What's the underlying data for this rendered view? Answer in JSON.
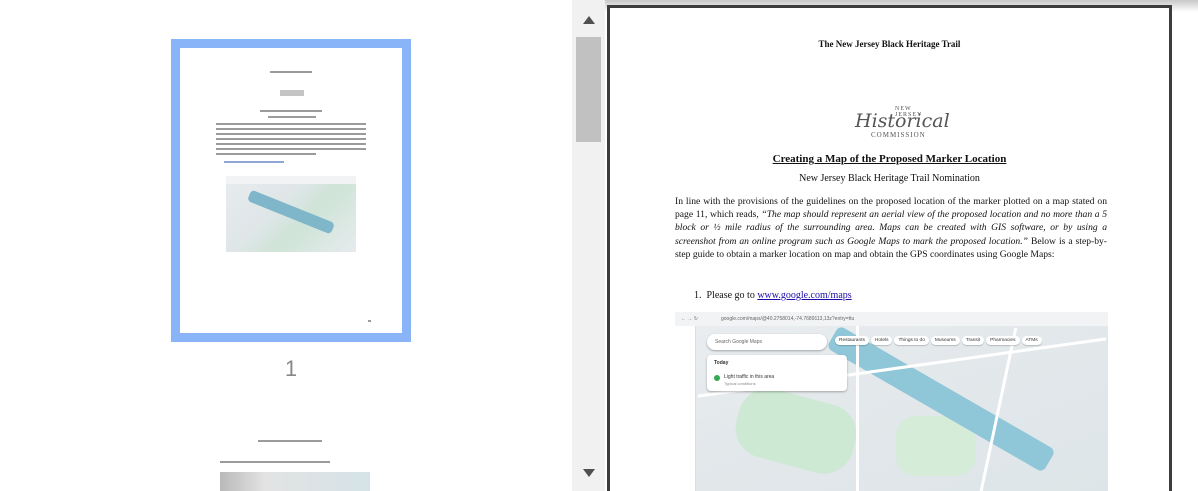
{
  "sidebar": {
    "page_number": "1"
  },
  "document": {
    "header": "The New Jersey Black Heritage Trail",
    "logo": {
      "top": "NEW JERSEY",
      "script": "Historical",
      "bottom": "COMMISSION"
    },
    "title": "Creating a Map of the Proposed Marker Location",
    "subtitle": "New Jersey Black Heritage Trail Nomination",
    "paragraph": {
      "part1": "In line with the provisions of the guidelines on the proposed location of the marker plotted on a map stated on page 11, which reads, ",
      "quote": "“The map should represent an aerial view of the proposed location and no more than a 5 block or ½ mile radius of the surrounding area. Maps can be created with GIS software, or by using a screenshot from an online program such as Google Maps to mark the proposed location.”",
      "part2": " Below is a step-by-step guide to obtain a marker location on map and obtain the GPS coordinates using Google Maps:"
    },
    "step1": {
      "number": "1.",
      "text": "Please go to ",
      "link": "www.google.com/maps"
    },
    "map": {
      "url": "google.com/maps/@40.2758014,-74.7689113,13z?entry=ttu",
      "search_placeholder": "Search Google Maps",
      "chips": [
        "Restaurants",
        "Hotels",
        "Things to do",
        "Museums",
        "Transit",
        "Pharmacies",
        "ATMs"
      ],
      "card_title": "Today",
      "card_status": "Light traffic in this area",
      "card_sub": "Typical conditions"
    }
  }
}
